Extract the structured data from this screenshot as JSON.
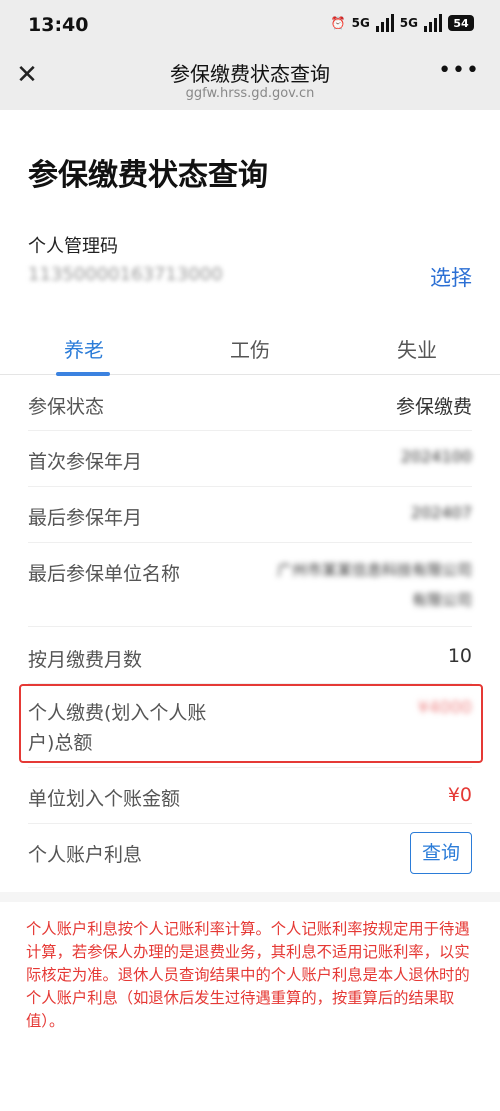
{
  "status_bar": {
    "time": "13:40",
    "network_1": "5G",
    "network_2": "5G",
    "battery": "54"
  },
  "navbar": {
    "title": "参保缴费状态查询",
    "url": "ggfw.hrss.gd.gov.cn",
    "close_icon": "close-icon",
    "more_icon": "more-icon"
  },
  "page": {
    "title": "参保缴费状态查询",
    "code_label": "个人管理码",
    "code_value": "11350000163713000",
    "select_label": "选择"
  },
  "tabs": [
    {
      "label": "养老",
      "active": true
    },
    {
      "label": "工伤",
      "active": false
    },
    {
      "label": "失业",
      "active": false
    }
  ],
  "rows": [
    {
      "label": "参保状态",
      "value": "参保缴费"
    },
    {
      "label": "首次参保年月",
      "value": "2024100"
    },
    {
      "label": "最后参保年月",
      "value": "202407"
    },
    {
      "label": "最后参保单位名称",
      "value_line1": "广州市某某信息科技有限公司",
      "value_line2": "有限公司"
    },
    {
      "label": "按月缴费月数",
      "value": "10"
    },
    {
      "label_line1": "个人缴费(划入个人账",
      "label_line2": "户)总额",
      "value": "¥4000"
    },
    {
      "label": "单位划入个账金额",
      "value": "¥0"
    },
    {
      "label": "个人账户利息",
      "button": "查询"
    }
  ],
  "colors": {
    "accent": "#2b7cd8",
    "highlight": "#e53935",
    "money": "#e53935"
  },
  "note": "个人账户利息按个人记账利率计算。个人记账利率按规定用于待遇计算，若参保人办理的是退费业务，其利息不适用记账利率，以实际核定为准。退休人员查询结果中的个人账户利息是本人退休时的个人账户利息（如退休后发生过待遇重算的，按重算后的结果取值）。"
}
